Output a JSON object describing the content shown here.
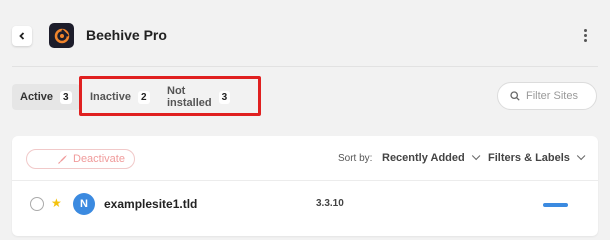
{
  "header": {
    "title": "Beehive Pro",
    "back_icon": "chevron-left-icon",
    "menu_icon": "kebab-menu-icon"
  },
  "tabs": [
    {
      "label": "Active",
      "count": "3",
      "active": true
    },
    {
      "label": "Inactive",
      "count": "2",
      "active": false
    },
    {
      "label": "Not installed",
      "count": "3",
      "active": false
    }
  ],
  "search": {
    "placeholder": "Filter Sites"
  },
  "toolbar": {
    "deactivate_label": "Deactivate",
    "sort_by_label": "Sort by:",
    "sort_value": "Recently Added",
    "filters_label": "Filters & Labels"
  },
  "sites": [
    {
      "avatar_letter": "N",
      "name": "examplesite1.tld",
      "version": "3.3.10",
      "starred": true
    }
  ],
  "colors": {
    "highlight": "#e02020",
    "accent": "#3b8ae0",
    "star": "#f4c20d",
    "deactivate": "#f09b9b"
  }
}
